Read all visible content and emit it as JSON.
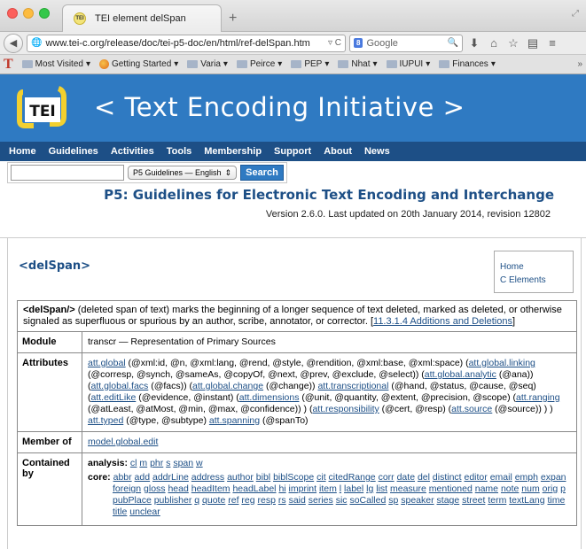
{
  "browser": {
    "tab_title": "TEI element delSpan",
    "new_tab": "+",
    "url": "www.tei-c.org/release/doc/tei-p5-doc/en/html/ref-delSpan.htm",
    "search_placeholder": "Google",
    "search_engine": "8"
  },
  "bookmarks": [
    {
      "label": "Most Visited",
      "icon": "folder"
    },
    {
      "label": "Getting Started",
      "icon": "firefox"
    },
    {
      "label": "Varia",
      "icon": "folder"
    },
    {
      "label": "Peirce",
      "icon": "folder"
    },
    {
      "label": "PEP",
      "icon": "folder"
    },
    {
      "label": "Nhat",
      "icon": "folder"
    },
    {
      "label": "IUPUI",
      "icon": "folder"
    },
    {
      "label": "Finances",
      "icon": "folder"
    }
  ],
  "banner": {
    "logo_text": "TEI",
    "title": "< Text Encoding Initiative >"
  },
  "menu": [
    "Home",
    "Guidelines",
    "Activities",
    "Tools",
    "Membership",
    "Support",
    "About",
    "News"
  ],
  "site_search": {
    "select": "P5 Guidelines — English",
    "button": "Search"
  },
  "heading": "P5: Guidelines for Electronic Text Encoding and Interchange",
  "version": "Version 2.6.0. Last updated on 20th January 2014, revision 12802",
  "element_title": "<delSpan>",
  "sidebox": [
    "Home",
    "C Elements"
  ],
  "description": {
    "tag": "<delSpan/>",
    "text": " (deleted span of text) marks the beginning of a longer sequence of text deleted, marked as deleted, or otherwise signaled as superfluous or spurious by an author, scribe, annotator, or corrector. [",
    "ref": "11.3.1.4 Additions and Deletions",
    "close": "]"
  },
  "module": {
    "label": "Module",
    "value": "transcr — Representation of Primary Sources"
  },
  "attributes": {
    "label": "Attributes",
    "parts": [
      {
        "t": "att.global",
        "l": true
      },
      {
        "t": " (@xml:id, @n, @xml:lang, @rend, @style, @rendition, @xml:base, @xml:space) (",
        "l": false
      },
      {
        "t": "att.global.linking",
        "l": true
      },
      {
        "t": " (@corresp, @synch, @sameAs, @copyOf, @next, @prev, @exclude, @select)) (",
        "l": false
      },
      {
        "t": "att.global.analytic",
        "l": true
      },
      {
        "t": " (@ana)) (",
        "l": false
      },
      {
        "t": "att.global.facs",
        "l": true
      },
      {
        "t": " (@facs)) (",
        "l": false
      },
      {
        "t": "att.global.change",
        "l": true
      },
      {
        "t": " (@change)) ",
        "l": false
      },
      {
        "t": "att.transcriptional",
        "l": true
      },
      {
        "t": " (@hand, @status, @cause, @seq) (",
        "l": false
      },
      {
        "t": "att.editLike",
        "l": true
      },
      {
        "t": " (@evidence, @instant) (",
        "l": false
      },
      {
        "t": "att.dimensions",
        "l": true
      },
      {
        "t": " (@unit, @quantity, @extent, @precision, @scope) (",
        "l": false
      },
      {
        "t": "att.ranging",
        "l": true
      },
      {
        "t": " (@atLeast, @atMost, @min, @max, @confidence)) ) (",
        "l": false
      },
      {
        "t": "att.responsibility",
        "l": true
      },
      {
        "t": " (@cert, @resp) (",
        "l": false
      },
      {
        "t": "att.source",
        "l": true
      },
      {
        "t": " (@source)) ) ) ",
        "l": false
      },
      {
        "t": "att.typed",
        "l": true
      },
      {
        "t": " (@type, @subtype) ",
        "l": false
      },
      {
        "t": "att.spanning",
        "l": true
      },
      {
        "t": " (@spanTo)",
        "l": false
      }
    ]
  },
  "member_of": {
    "label": "Member of",
    "value": "model.global.edit"
  },
  "contained_by": {
    "label": "Contained by",
    "analysis_label": "analysis:",
    "analysis": [
      "cl",
      "m",
      "phr",
      "s",
      "span",
      "w"
    ],
    "core_label": "core:",
    "core": [
      "abbr",
      "add",
      "addrLine",
      "address",
      "author",
      "bibl",
      "biblScope",
      "cit",
      "citedRange",
      "corr",
      "date",
      "del",
      "distinct",
      "editor",
      "email",
      "emph",
      "expan",
      "foreign",
      "gloss",
      "head",
      "headItem",
      "headLabel",
      "hi",
      "imprint",
      "item",
      "l",
      "label",
      "lg",
      "list",
      "measure",
      "mentioned",
      "name",
      "note",
      "num",
      "orig",
      "p",
      "pubPlace",
      "publisher",
      "q",
      "quote",
      "ref",
      "reg",
      "resp",
      "rs",
      "said",
      "series",
      "sic",
      "soCalled",
      "sp",
      "speaker",
      "stage",
      "street",
      "term",
      "textLang",
      "time",
      "title",
      "unclear"
    ]
  }
}
